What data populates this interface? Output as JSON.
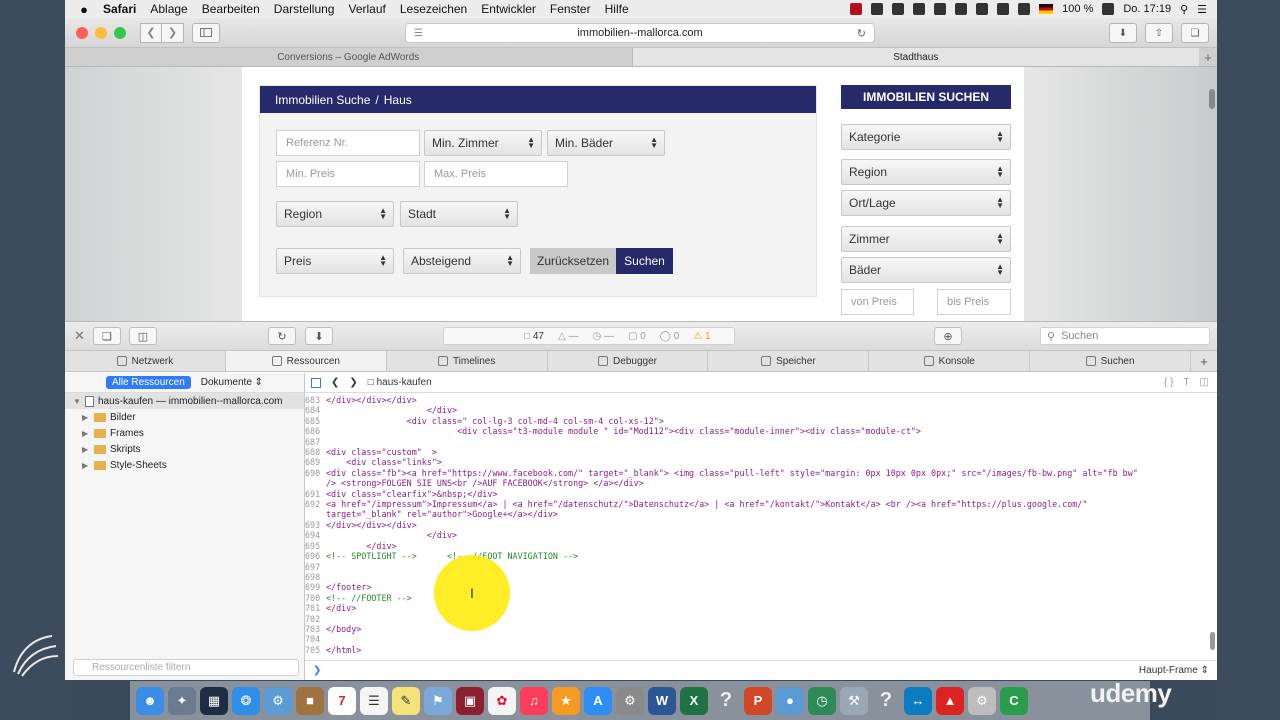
{
  "menubar": {
    "app": "Safari",
    "items": [
      "Ablage",
      "Bearbeiten",
      "Darstellung",
      "Verlauf",
      "Lesezeichen",
      "Entwickler",
      "Fenster",
      "Hilfe"
    ],
    "battery": "100 %",
    "clock": "Do. 17:19"
  },
  "browser": {
    "url": "immobilien--mallorca.com",
    "tabs": [
      "Conversions – Google AdWords",
      "Stadthaus"
    ]
  },
  "page": {
    "breadcrumb_root": "Immobilien Suche",
    "breadcrumb_sep": "/",
    "breadcrumb_current": "Haus",
    "fields": {
      "referenz": "Referenz Nr.",
      "min_zimmer": "Min. Zimmer",
      "min_baeder": "Min. Bäder",
      "min_preis": "Min. Preis",
      "max_preis": "Max. Preis",
      "region": "Region",
      "stadt": "Stadt",
      "preis": "Preis",
      "sort": "Absteigend",
      "reset": "Zurücksetzen",
      "search": "Suchen"
    },
    "sidebar": {
      "title": "IMMOBILIEN SUCHEN",
      "kategorie": "Kategorie",
      "region": "Region",
      "ort": "Ort/Lage",
      "zimmer": "Zimmer",
      "baeder": "Bäder",
      "von_preis": "von Preis",
      "bis_preis": "bis Preis"
    }
  },
  "inspector": {
    "resource_count": "47",
    "activity": [
      "—",
      "—",
      "0",
      "0",
      "1"
    ],
    "search_placeholder": "Suchen",
    "tabs": [
      "Netzwerk",
      "Ressourcen",
      "Timelines",
      "Debugger",
      "Speicher",
      "Konsole",
      "Suchen"
    ],
    "filter_all": "Alle Ressourcen",
    "filter_docs": "Dokumente",
    "tree_root": "haus-kaufen — immobilien--mallorca.com",
    "tree_children": [
      "Bilder",
      "Frames",
      "Skripts",
      "Style-Sheets"
    ],
    "filter_placeholder": "Ressourcenliste filtern",
    "file": "haus-kaufen",
    "frame": "Haupt-Frame",
    "code_lines": [
      {
        "n": "683",
        "t": "</div></div></div>",
        "c": "tag"
      },
      {
        "n": "684",
        "t": "                    </div>",
        "c": "tag"
      },
      {
        "n": "685",
        "t": "                <div class=\" col-lg-3 col-md-4 col-sm-4 col-xs-12\">",
        "c": "tag"
      },
      {
        "n": "686",
        "t": "                          <div class=\"t3-module module \" id=\"Mod112\"><div class=\"module-inner\"><div class=\"module-ct\">",
        "c": "tag"
      },
      {
        "n": "687",
        "t": "",
        "c": "tag"
      },
      {
        "n": "688",
        "t": "<div class=\"custom\"  >",
        "c": "tag"
      },
      {
        "n": "689",
        "t": "    <div class=\"links\">",
        "c": "tag"
      },
      {
        "n": "690",
        "t": "<div class=\"fb\"><a href=\"https://www.facebook.com/\" target=\"_blank\"> <img class=\"pull-left\" style=\"margin: 0px 10px 0px 0px;\" src=\"/images/fb-bw.png\" alt=\"fb bw\"",
        "c": "tag"
      },
      {
        "n": "",
        "t": "/> <strong>FOLGEN SIE UNS<br />AUF FACEBOOK</strong> </a></div>",
        "c": "tag"
      },
      {
        "n": "691",
        "t": "<div class=\"clearfix\">&nbsp;</div>",
        "c": "tag"
      },
      {
        "n": "692",
        "t": "<a href=\"/impressum\">Impressum</a> | <a href=\"/datenschutz/\">Datenschutz</a> | <a href=\"/kontakt/\">Kontakt</a> <br /><a href=\"https://plus.google.com/\"",
        "c": "tag"
      },
      {
        "n": "",
        "t": "target=\"_blank\" rel=\"author\">Google+</a></div>",
        "c": "tag"
      },
      {
        "n": "693",
        "t": "</div></div></div>",
        "c": "tag"
      },
      {
        "n": "694",
        "t": "                    </div>",
        "c": "tag"
      },
      {
        "n": "695",
        "t": "        </div>",
        "c": "tag"
      },
      {
        "n": "696",
        "t": "<!-- SPOTLIGHT -->      <!-- //FOOT NAVIGATION -->",
        "c": "comment"
      },
      {
        "n": "697",
        "t": "",
        "c": "tag"
      },
      {
        "n": "698",
        "t": "",
        "c": "tag"
      },
      {
        "n": "699",
        "t": "</footer>",
        "c": "tag"
      },
      {
        "n": "700",
        "t": "<!-- //FOOTER -->",
        "c": "comment"
      },
      {
        "n": "701",
        "t": "</div>",
        "c": "tag"
      },
      {
        "n": "702",
        "t": "",
        "c": "tag"
      },
      {
        "n": "703",
        "t": "</body>",
        "c": "tag"
      },
      {
        "n": "704",
        "t": "",
        "c": "tag"
      },
      {
        "n": "705",
        "t": "</html>",
        "c": "tag"
      }
    ]
  },
  "dock": {
    "calendar_day": "7",
    "brand": "udemy"
  }
}
